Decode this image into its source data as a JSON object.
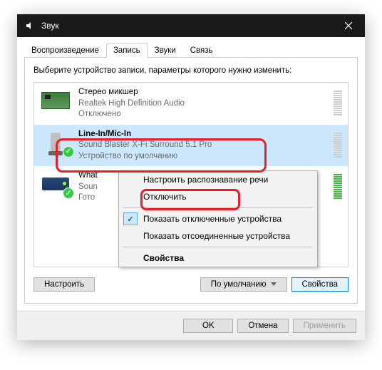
{
  "title": "Звук",
  "tabs": [
    "Воспроизведение",
    "Запись",
    "Звуки",
    "Связь"
  ],
  "activeTab": 1,
  "instruction": "Выберите устройство записи, параметры которого нужно изменить:",
  "devices": [
    {
      "name": "Стерео микшер",
      "driver": "Realtek High Definition Audio",
      "status": "Отключено",
      "selected": false,
      "default": false,
      "iconType": "card",
      "meter": "gray"
    },
    {
      "name": "Line-In/Mic-In",
      "driver": "Sound Blaster X-Fi Surround 5.1 Pro",
      "status": "Устройство по умолчанию",
      "selected": true,
      "default": true,
      "iconType": "mic",
      "meter": "gray"
    },
    {
      "name": "What",
      "driver": "Soun",
      "status": "Гото",
      "selected": false,
      "default": true,
      "iconType": "box",
      "meter": "green"
    }
  ],
  "contextMenu": {
    "configure": "Настроить распознавание речи",
    "disable": "Отключить",
    "showDisabled": "Показать отключенные устройства",
    "showDisconnected": "Показать отсоединенные устройства",
    "properties": "Свойства"
  },
  "buttons": {
    "configure": "Настроить",
    "setDefault": "По умолчанию",
    "properties": "Свойства",
    "ok": "OK",
    "cancel": "Отмена",
    "apply": "Применить"
  }
}
